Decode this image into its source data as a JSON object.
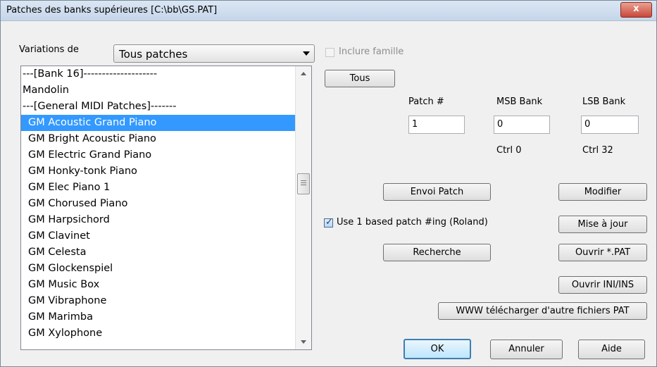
{
  "window": {
    "title": "Patches des banks supérieures [C:\\bb\\GS.PAT]",
    "close_glyph": "x"
  },
  "variations": {
    "label": "Variations de",
    "selected": "Tous patches"
  },
  "include_family": {
    "label": "Inclure famille",
    "checked": false,
    "enabled": false
  },
  "tous_button": "Tous",
  "patch_list": {
    "items": [
      "---[Bank 16]--------------------",
      "Mandolin",
      "---[General MIDI Patches]-------",
      "GM Acoustic Grand Piano",
      "GM Bright Acoustic Piano",
      "GM Electric Grand Piano",
      "GM Honky-tonk Piano",
      "GM Elec Piano 1",
      "GM Chorused Piano",
      "GM Harpsichord",
      "GM Clavinet",
      "GM Celesta",
      "GM Glockenspiel",
      "GM Music Box",
      "GM Vibraphone",
      "GM Marimba",
      "GM Xylophone"
    ],
    "selected": "GM Acoustic Grand Piano"
  },
  "patch_fields": {
    "patch_label": "Patch #",
    "patch_value": "1",
    "msb_label": "MSB Bank",
    "msb_value": "0",
    "msb_ctrl": "Ctrl 0",
    "lsb_label": "LSB Bank",
    "lsb_value": "0",
    "lsb_ctrl": "Ctrl 32"
  },
  "buttons": {
    "send_patch": "Envoi Patch",
    "modify": "Modifier",
    "update": "Mise à jour",
    "search": "Recherche",
    "open_pat": "Ouvrir *.PAT",
    "open_ini": "Ouvrir INI/INS",
    "www_download": "WWW télécharger d'autre fichiers PAT",
    "ok": "OK",
    "cancel": "Annuler",
    "help": "Aide"
  },
  "use_one_based": {
    "label": "Use 1 based patch #ing (Roland)",
    "checked": true
  },
  "colors": {
    "selection": "#3399ff",
    "window_bg": "#f0f0f0"
  }
}
